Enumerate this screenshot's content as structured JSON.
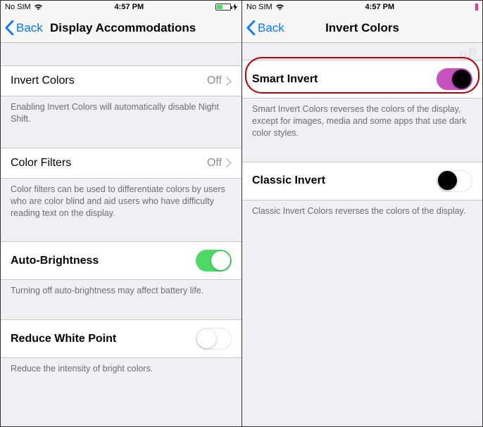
{
  "left": {
    "status": {
      "carrier": "No SIM",
      "time": "4:57 PM"
    },
    "nav": {
      "back": "Back",
      "title": "Display Accommodations"
    },
    "rows": {
      "invertColors": {
        "label": "Invert Colors",
        "value": "Off",
        "footer": "Enabling Invert Colors will automatically disable Night Shift."
      },
      "colorFilters": {
        "label": "Color Filters",
        "value": "Off",
        "footer": "Color filters can be used to differentiate colors by users who are color blind and aid users who have difficulty reading text on the display."
      },
      "autoBrightness": {
        "label": "Auto-Brightness",
        "footer": "Turning off auto-brightness may affect battery life."
      },
      "reduceWhitePoint": {
        "label": "Reduce White Point",
        "footer": "Reduce the intensity of bright colors."
      }
    }
  },
  "right": {
    "status": {
      "carrier": "No SIM",
      "time": "4:57 PM"
    },
    "nav": {
      "back": "Back",
      "title": "Invert Colors"
    },
    "rows": {
      "smartInvert": {
        "label": "Smart Invert",
        "footer": "Smart Invert Colors reverses the colors of the display, except for images, media and some apps that use dark color styles."
      },
      "classicInvert": {
        "label": "Classic Invert",
        "footer": "Classic Invert Colors reverses the colors of the display."
      }
    }
  }
}
